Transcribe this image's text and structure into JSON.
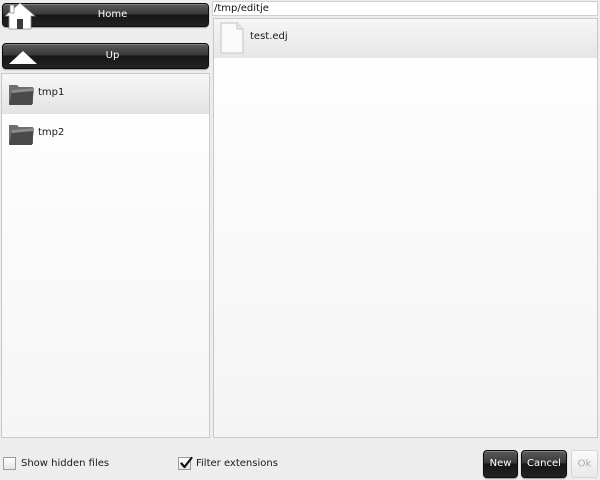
{
  "toolbar": {
    "home_label": "Home",
    "up_label": "Up",
    "home_icon": "home-icon",
    "up_icon": "up-arrow-icon"
  },
  "path": {
    "value": "/tmp/editje"
  },
  "folders": [
    {
      "name": "tmp1",
      "icon": "folder-icon",
      "selected": true
    },
    {
      "name": "tmp2",
      "icon": "folder-icon",
      "selected": false
    }
  ],
  "files": [
    {
      "name": "test.edj",
      "icon": "file-icon"
    }
  ],
  "options": {
    "show_hidden_label": "Show hidden files",
    "show_hidden_checked": false,
    "filter_extensions_label": "Filter extensions",
    "filter_extensions_checked": true
  },
  "actions": {
    "new_label": "New",
    "cancel_label": "Cancel",
    "ok_label": "Ok",
    "ok_enabled": false
  },
  "colors": {
    "button_dark": "#222222",
    "button_text": "#ffffff",
    "disabled_text": "#a9a9a9",
    "list_background": "#ffffff"
  }
}
